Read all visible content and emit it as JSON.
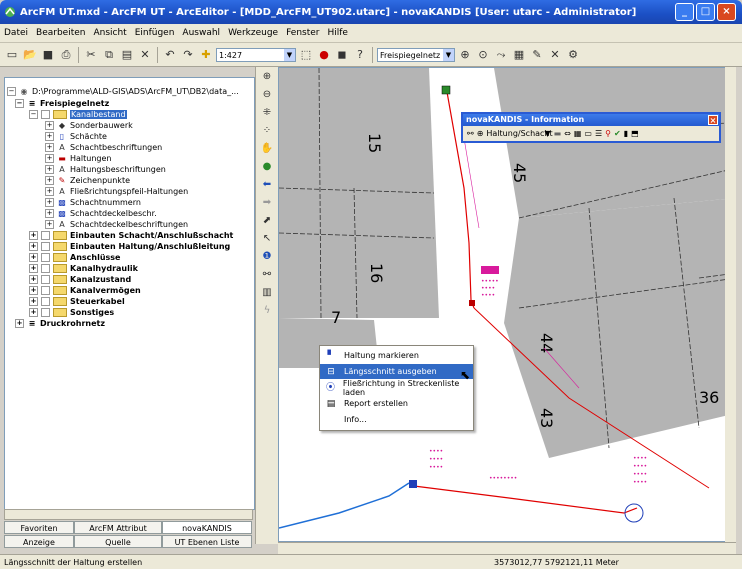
{
  "window": {
    "title": "ArcFM UT.mxd - ArcFM UT - ArcEditor - [MDD_ArcFM_UT902.utarc] - novaKANDIS [User: utarc - Administrator]",
    "buttons": [
      "_",
      "□",
      "×"
    ]
  },
  "menu": [
    "Datei",
    "Bearbeiten",
    "Ansicht",
    "Einfügen",
    "Auswahl",
    "Werkzeuge",
    "Fenster",
    "Hilfe"
  ],
  "toolbar": {
    "scale": "1:427",
    "layer_combo": "Freispiegelnetz"
  },
  "toc": {
    "root": "D:\\Programme\\ALD-GIS\\ADS\\ArcFM_UT\\DB2\\data_...",
    "items": [
      {
        "label": "Freispiegelnetz",
        "level": 1,
        "type": "group"
      },
      {
        "label": "Kanalbestand",
        "level": 2,
        "type": "folder",
        "selected": true
      },
      {
        "label": "Sonderbauwerk",
        "level": 3,
        "type": "layer"
      },
      {
        "label": "Schächte",
        "level": 3,
        "type": "layer"
      },
      {
        "label": "Schachtbeschriftungen",
        "level": 3,
        "type": "layer"
      },
      {
        "label": "Haltungen",
        "level": 3,
        "type": "layer"
      },
      {
        "label": "Haltungsbeschriftungen",
        "level": 3,
        "type": "layer"
      },
      {
        "label": "Zeichenpunkte",
        "level": 3,
        "type": "layer"
      },
      {
        "label": "Fließrichtungspfeil-Haltungen",
        "level": 3,
        "type": "layer"
      },
      {
        "label": "Schachtnummern",
        "level": 3,
        "type": "layer"
      },
      {
        "label": "Schachtdeckelbeschr.",
        "level": 3,
        "type": "layer"
      },
      {
        "label": "Schachtdeckelbeschriftungen",
        "level": 3,
        "type": "layer"
      },
      {
        "label": "Einbauten Schacht/Anschlußschacht",
        "level": 2,
        "type": "folder"
      },
      {
        "label": "Einbauten Haltung/Anschlußleitung",
        "level": 2,
        "type": "folder"
      },
      {
        "label": "Anschlüsse",
        "level": 2,
        "type": "folder"
      },
      {
        "label": "Kanalhydraulik",
        "level": 2,
        "type": "folder"
      },
      {
        "label": "Kanalzustand",
        "level": 2,
        "type": "folder"
      },
      {
        "label": "Kanalvermögen",
        "level": 2,
        "type": "folder"
      },
      {
        "label": "Steuerkabel",
        "level": 2,
        "type": "folder"
      },
      {
        "label": "Sonstiges",
        "level": 2,
        "type": "folder"
      },
      {
        "label": "Druckrohrnetz",
        "level": 1,
        "type": "group"
      }
    ]
  },
  "toc_tabs_row1": [
    "Favoriten",
    "ArcFM Attribut",
    "novaKANDIS"
  ],
  "toc_tabs_row2": [
    "Anzeige",
    "Quelle",
    "UT Ebenen Liste"
  ],
  "info_panel": {
    "title": "novaKANDIS - Information",
    "dropdown": "Haltung/Schacht"
  },
  "context_menu": [
    {
      "label": "Haltung markieren",
      "icon": "mark-icon"
    },
    {
      "label": "Längsschnitt ausgeben",
      "icon": "profile-icon",
      "highlighted": true
    },
    {
      "label": "Fließrichtung in Streckenliste laden",
      "icon": "flow-icon"
    },
    {
      "label": "Report erstellen",
      "icon": "report-icon"
    },
    {
      "label": "Info...",
      "icon": "info-icon"
    }
  ],
  "map_labels": {
    "parcels": [
      "15",
      "16",
      "7",
      "45",
      "44",
      "43",
      "36"
    ]
  },
  "status": {
    "left": "Längsschnitt der Haltung erstellen",
    "right": "3573012,77 5792121,11 Meter"
  }
}
